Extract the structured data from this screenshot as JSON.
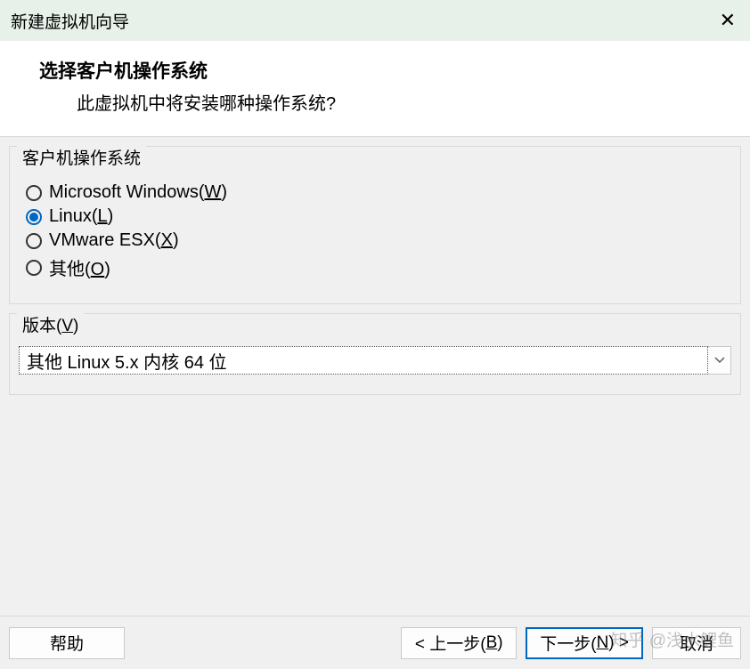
{
  "title": "新建虚拟机向导",
  "header": {
    "heading": "选择客户机操作系统",
    "sub": "此虚拟机中将安装哪种操作系统?"
  },
  "os_group": {
    "legend": "客户机操作系统",
    "options": [
      {
        "label_pre": "Microsoft Windows(",
        "shortcut": "W",
        "label_post": ")",
        "selected": false
      },
      {
        "label_pre": "Linux(",
        "shortcut": "L",
        "label_post": ")",
        "selected": true
      },
      {
        "label_pre": "VMware ESX(",
        "shortcut": "X",
        "label_post": ")",
        "selected": false
      },
      {
        "label_pre": "其他(",
        "shortcut": "O",
        "label_post": ")",
        "selected": false
      }
    ]
  },
  "version_group": {
    "legend_pre": "版本(",
    "legend_shortcut": "V",
    "legend_post": ")",
    "selected": "其他 Linux 5.x 内核 64 位"
  },
  "buttons": {
    "help": "帮助",
    "back_pre": "< 上一步(",
    "back_shortcut": "B",
    "back_post": ")",
    "next_pre": "下一步(",
    "next_shortcut": "N",
    "next_post": ") >",
    "cancel": "取消"
  },
  "watermark": "知乎 @浅水鲤鱼"
}
